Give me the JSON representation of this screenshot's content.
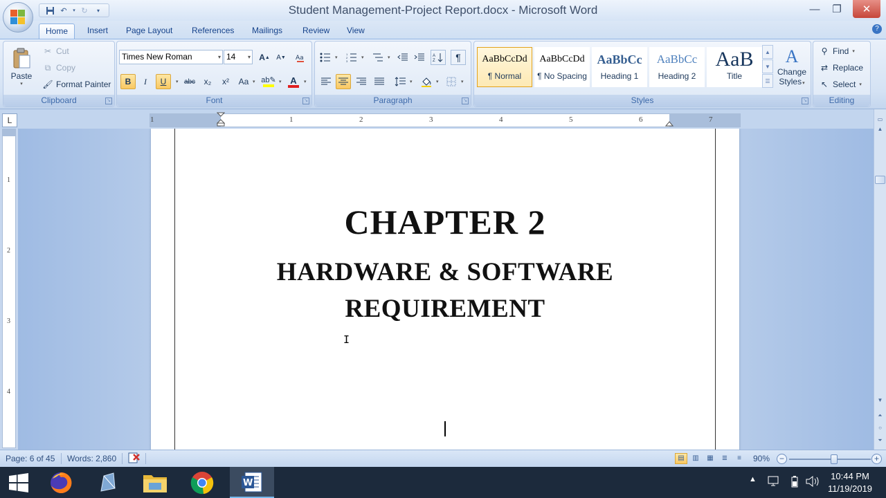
{
  "window": {
    "title": "Student Management-Project Report.docx - Microsoft Word",
    "controls": {
      "minimize": "—",
      "maximize": "❐",
      "close": "✕"
    }
  },
  "quick_access": {
    "save_icon": "save-icon",
    "undo_icon": "undo-icon",
    "redo_icon": "redo-icon",
    "customize_icon": "customize-icon"
  },
  "tabs": [
    {
      "label": "Home",
      "active": true
    },
    {
      "label": "Insert"
    },
    {
      "label": "Page Layout"
    },
    {
      "label": "References"
    },
    {
      "label": "Mailings"
    },
    {
      "label": "Review"
    },
    {
      "label": "View"
    }
  ],
  "ribbon": {
    "clipboard": {
      "label": "Clipboard",
      "paste": "Paste",
      "cut": "Cut",
      "copy": "Copy",
      "format_painter": "Format Painter"
    },
    "font": {
      "label": "Font",
      "font_name": "Times New Roman",
      "font_size": "14",
      "bold": "B",
      "italic": "I",
      "underline": "U",
      "strikethrough": "abc",
      "subscript": "x₂",
      "superscript": "x²",
      "change_case": "Aa",
      "highlight_color": "#ffff00",
      "font_color": "#e02020"
    },
    "paragraph": {
      "label": "Paragraph"
    },
    "styles": {
      "label": "Styles",
      "items": [
        {
          "sample": "AaBbCcDd",
          "name": "¶ Normal",
          "selected": true
        },
        {
          "sample": "AaBbCcDd",
          "name": "¶ No Spacing"
        },
        {
          "sample": "AaBbCc",
          "name": "Heading 1"
        },
        {
          "sample": "AaBbCc",
          "name": "Heading 2"
        },
        {
          "sample": "AaB",
          "name": "Title"
        }
      ],
      "change_styles_line1": "Change",
      "change_styles_line2": "Styles"
    },
    "editing": {
      "label": "Editing",
      "find": "Find",
      "replace": "Replace",
      "select": "Select"
    }
  },
  "ruler": {
    "numbers": [
      "1",
      "1",
      "2",
      "3",
      "4",
      "5",
      "6",
      "7"
    ],
    "vertical_numbers": [
      "1",
      "2",
      "3",
      "4"
    ]
  },
  "document": {
    "chapter": "CHAPTER 2",
    "title_line1": "HARDWARE & SOFTWARE",
    "title_line2": "REQUIREMENT"
  },
  "status_bar": {
    "page": "Page: 6 of 45",
    "words": "Words: 2,860",
    "zoom": "90%",
    "zoom_level": 0.55
  },
  "taskbar": {
    "apps": [
      "firefox-icon",
      "pen-tool-icon",
      "file-explorer-icon",
      "chrome-icon",
      "word-icon"
    ],
    "active_app": "word-icon",
    "time": "10:44 PM",
    "date": "11/19/2019"
  },
  "colors": {
    "accent": "#15428b",
    "ribbon_bg": "#dbe7f6",
    "taskbar": "#1c2a3c",
    "selected_style": "#e3a21a"
  }
}
